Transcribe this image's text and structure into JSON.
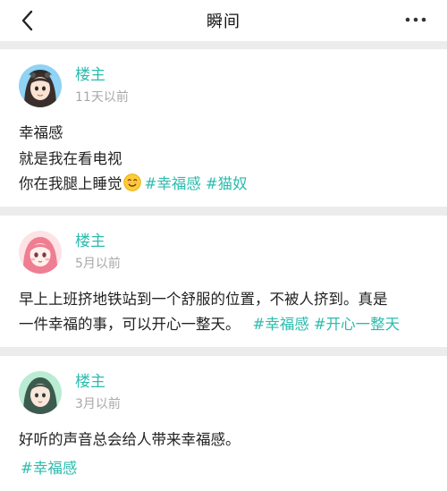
{
  "header": {
    "title": "瞬间",
    "back_icon": "chevron-left-icon",
    "more_icon": "more-dots-icon"
  },
  "posts": [
    {
      "author": "楼主",
      "time": "11天以前",
      "lines": [
        "幸福感",
        "就是我在看电视",
        "你在我腿上睡觉"
      ],
      "emoji": "smiling-face-icon",
      "tags": [
        "#幸福感",
        "#猫奴"
      ]
    },
    {
      "author": "楼主",
      "time": "5月以前",
      "lines": [
        "早上上班挤地铁站到一个舒服的位置，不被人挤到。真是",
        "一件幸福的事，可以开心一整天。"
      ],
      "tags": [
        "#幸福感",
        "#开心一整天"
      ]
    },
    {
      "author": "楼主",
      "time": "3月以前",
      "lines": [
        "好听的声音总会给人带来幸福感。"
      ],
      "tags": [
        "#幸福感"
      ]
    }
  ],
  "colors": {
    "accent": "#2bbcad",
    "background": "#ececec",
    "time_text": "#a8a8a8"
  }
}
